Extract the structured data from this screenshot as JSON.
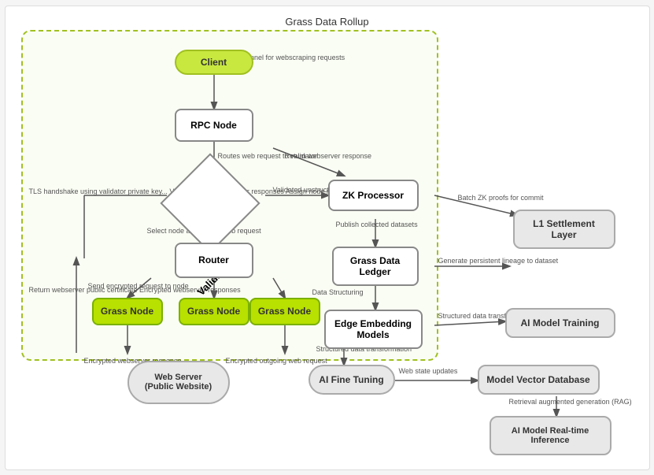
{
  "title": "Grass  Data Rollup",
  "nodes": {
    "client": {
      "label": "Client"
    },
    "rpc_node": {
      "label": "RPC Node"
    },
    "validator": {
      "label": "Validator"
    },
    "router": {
      "label": "Router"
    },
    "grass_node_1": {
      "label": "Grass Node"
    },
    "grass_node_2": {
      "label": "Grass Node"
    },
    "grass_node_3": {
      "label": "Grass Node"
    },
    "web_server": {
      "label": "Web Server\n(Public Website)"
    },
    "zk_processor": {
      "label": "ZK Processor"
    },
    "grass_data_ledger": {
      "label": "Grass Data\nLedger"
    },
    "edge_embedding": {
      "label": "Edge Embedding\nModels"
    },
    "ai_fine_tuning": {
      "label": "AI Fine Tuning"
    },
    "l1_settlement": {
      "label": "L1 Settlement\nLayer"
    },
    "ai_model_training": {
      "label": "AI Model Training"
    },
    "model_vector_db": {
      "label": "Model Vector Database"
    },
    "ai_inference": {
      "label": "AI Model Real-time\nInference"
    }
  },
  "arrow_labels": {
    "client_to_rpc": "Initiate tunnel for\nwebscraping requests",
    "rpc_to_validator": "Routes web request\nto validator",
    "rpc_webserver_return": "Return webserver\nresponse",
    "validator_tls": "TLS handshake using\nvalidator private key...\nValidate encrypted\nserver responses\nAssign node\nreputation",
    "validator_to_zk": "Validated\nunstructured data",
    "validator_to_router": "Select node and initiate\nweb request",
    "router_to_node": "Send encrypted\nrequest to node",
    "webserver_return": "Return webserver\npublic certificate\nEncrypted webserver\nresponses",
    "encrypted_response": "Encrypted webserver\nresponse",
    "encrypted_outgoing": "Encrypted outgoing\nweb request",
    "zk_batch": "Batch ZK proofs\nfor commit",
    "zk_publish": "Publish collected\ndatasets",
    "ledger_to_edge": "Data Structuring",
    "ledger_persistent": "Generate persistent\nlineage to dataset",
    "edge_structured": "Structured data\ntransformation",
    "edge_to_training": "Structured data\ntransformation",
    "fine_tuning_web": "Web state\nupdates",
    "rag": "Retrieval augmented\ngeneration (RAG)"
  }
}
